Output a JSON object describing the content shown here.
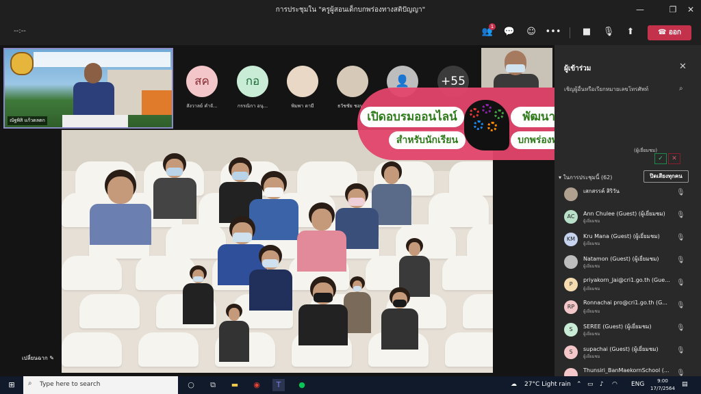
{
  "window": {
    "title": "การประชุมใน \"ครูผู้สอนเด็กบกพร่องทางสติปัญญา\""
  },
  "toolbar": {
    "timer": "--:--",
    "participants_badge": "1",
    "leave_label": "ออก"
  },
  "pinned": {
    "name": "ณัฐพิสิ แก้วดลตก"
  },
  "avatars": [
    {
      "initials": "สค",
      "name": "สังวาลย์ คำจั...",
      "color": "#f3c7c9",
      "text_color": "#8a2a33"
    },
    {
      "initials": "กอ",
      "name": "กรรณิกา อนุ...",
      "color": "#c8ecd6",
      "text_color": "#1e6b3a"
    },
    {
      "initials": "",
      "name": "พิมพา ดามี",
      "color": "#e9d8c6",
      "text_color": "#333"
    },
    {
      "initials": "",
      "name": "ธวัชชัย ชอบ...",
      "color": "#d6c9b8",
      "text_color": "#333"
    },
    {
      "initials": "",
      "name": "",
      "color": "#bdbdbd",
      "text_color": "#555"
    },
    {
      "initials": "+55",
      "name": "",
      "color": "#3b3b3b",
      "text_color": "#fff"
    }
  ],
  "stage": {
    "change_background": "เปลี่ยนฉาก"
  },
  "banner": {
    "line1_left": "เปิดอบรมออนไลน์",
    "line1_right": "พัฒนาคุณภาพการจัดการเรียนรู้",
    "line2_left": "สำหรับนักเรียน",
    "line2_right": "บกพร่องทางสติปัญญา"
  },
  "panel": {
    "title": "ผู้เข้าร่วม",
    "search_placeholder": "เชิญผู้อื่นหรือเรียกหมายเลขโทรศัพท์",
    "lobby_accept": "✓",
    "lobby_deny": "✕",
    "lobby_tag": "(ผู้เยี่ยมชม)",
    "section_label": "ในการประชุมนี้ (62)",
    "mute_all": "ปิดเสียงทุกคน",
    "participants": [
      {
        "initials": "",
        "name": "เสกสรรค์ สิริวัน",
        "role": "",
        "color": "#b0a090"
      },
      {
        "initials": "AC",
        "name": "Ann Chulee (Guest) (ผู้เยี่ยมชม)",
        "role": "ผู้เยี่ยมชม",
        "color": "#b8e0c8"
      },
      {
        "initials": "KM",
        "name": "Kru Mana (Guest) (ผู้เยี่ยมชม)",
        "role": "ผู้เยี่ยมชม",
        "color": "#c6d4f0"
      },
      {
        "initials": "",
        "name": "Natamon (Guest) (ผู้เยี่ยมชม)",
        "role": "ผู้เยี่ยมชม",
        "color": "#bdbdbd"
      },
      {
        "initials": "P",
        "name": "priyakorn_Jai@cri1.go.th (Gue...",
        "role": "ผู้เยี่ยมชม",
        "color": "#f5dcb0"
      },
      {
        "initials": "RP",
        "name": "Ronnachai pro@cri1.go.th (G...",
        "role": "ผู้เยี่ยมชม",
        "color": "#f3c7c9"
      },
      {
        "initials": "S",
        "name": "SEREE (Guest) (ผู้เยี่ยมชม)",
        "role": "ผู้เยี่ยมชม",
        "color": "#c8ecd6"
      },
      {
        "initials": "S",
        "name": "supachai (Guest) (ผู้เยี่ยมชม)",
        "role": "ผู้เยี่ยมชม",
        "color": "#f3c7c9"
      },
      {
        "initials": "",
        "name": "Thunsiri_BanMaekornSchool (...",
        "role": "",
        "color": "#f3c7c9"
      }
    ]
  },
  "taskbar": {
    "search_placeholder": "Type here to search",
    "weather": "27°C  Light rain",
    "lang": "ENG",
    "time": "9:00",
    "date": "17/7/2564"
  }
}
